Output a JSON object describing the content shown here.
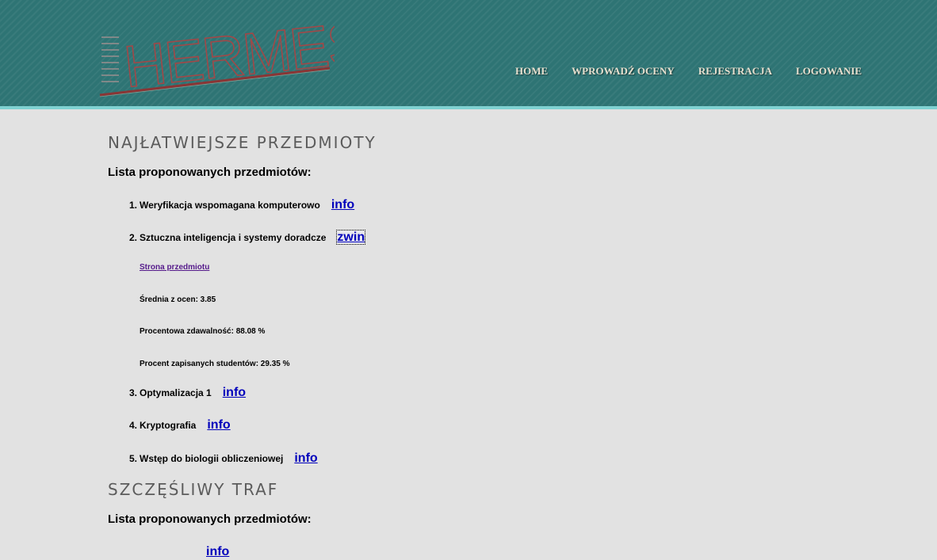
{
  "logo": {
    "text": "HERMES"
  },
  "nav": [
    "HOME",
    "WPROWADŹ OCENY",
    "REJESTRACJA",
    "LOGOWANIE"
  ],
  "sections": [
    {
      "title": "NAJŁATWIEJSZE PRZEDMIOTY",
      "list_heading": "Lista proponowanych przedmiotów:",
      "items": [
        {
          "num": "1.",
          "name": "Weryfikacja wspomagana komputerowo",
          "toggle": "info"
        },
        {
          "num": "2.",
          "name": "Sztuczna inteligencja i systemy doradcze",
          "toggle": "zwin",
          "details": {
            "link": "Strona przedmiotu",
            "average": "Średnia z ocen: 3.85",
            "pass_rate": "Procentowa zdawalność: 88.08 %",
            "enrolled": "Procent zapisanych studentów: 29.35 %"
          }
        },
        {
          "num": "3.",
          "name": "Optymalizacja 1",
          "toggle": "info"
        },
        {
          "num": "4.",
          "name": "Kryptografia",
          "toggle": "info"
        },
        {
          "num": "5.",
          "name": "Wstęp do biologii obliczeniowej",
          "toggle": "info"
        }
      ]
    },
    {
      "title": "SZCZĘŚLIWY TRAF",
      "list_heading": "Lista proponowanych przedmiotów:",
      "items": [
        {
          "num": "",
          "name": "",
          "toggle": "info"
        }
      ]
    }
  ]
}
